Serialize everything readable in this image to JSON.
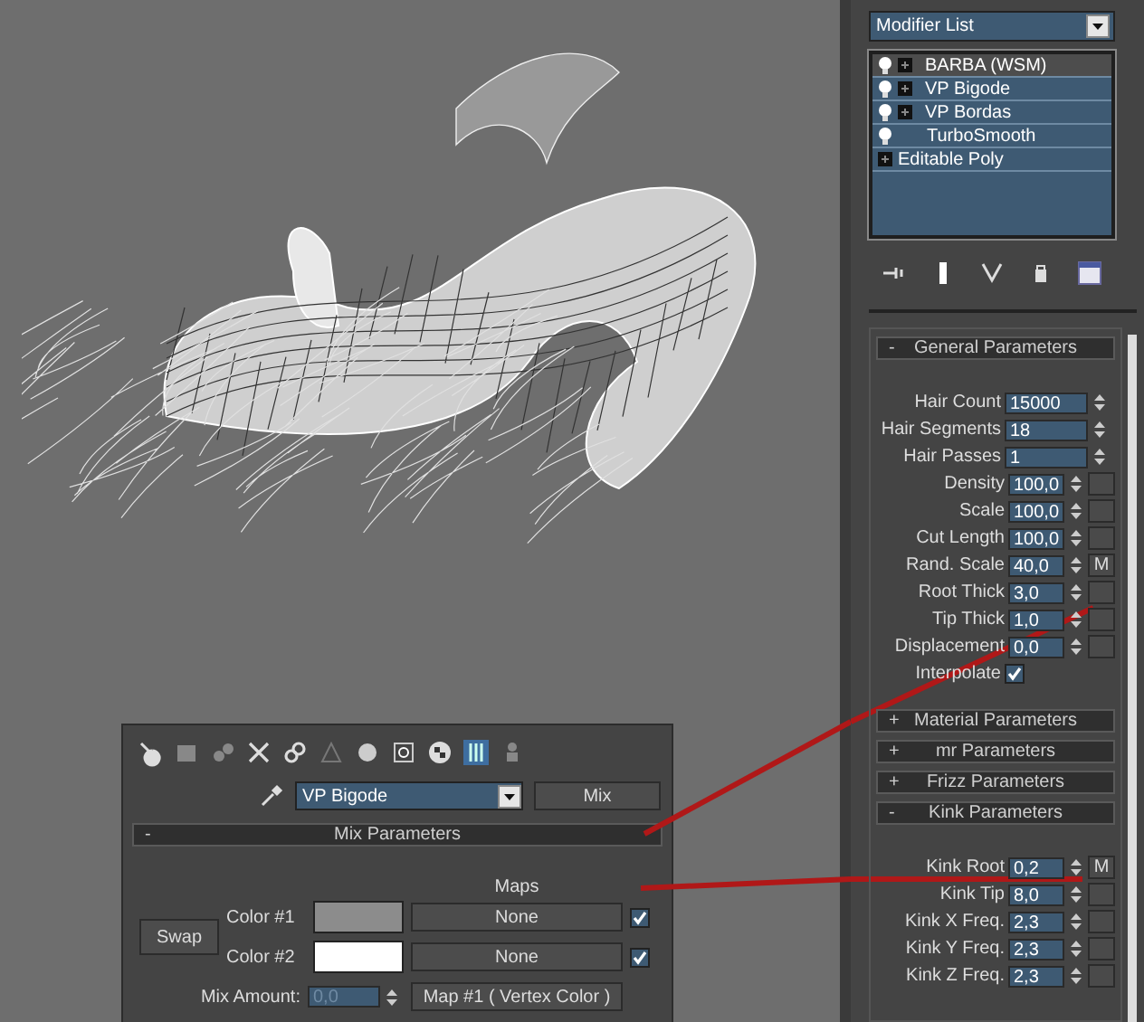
{
  "command_panel": {
    "modifier_list": {
      "label": "Modifier List"
    },
    "modifier_stack": [
      {
        "name": "BARBA (WSM)",
        "kind": "wsm",
        "selected": true
      },
      {
        "name": "VP Bigode",
        "kind": "group",
        "selected": false
      },
      {
        "name": "VP Bordas",
        "kind": "group",
        "selected": false
      },
      {
        "name": "TurboSmooth",
        "kind": "modifier",
        "selected": false
      },
      {
        "name": "Editable Poly",
        "kind": "base",
        "selected": false
      }
    ],
    "rollouts": [
      {
        "sign": "-",
        "title": "General Parameters",
        "params": [
          {
            "label": "Hair Count",
            "value": "15000",
            "kind": "wide"
          },
          {
            "label": "Hair Segments",
            "value": "18",
            "kind": "wide"
          },
          {
            "label": "Hair Passes",
            "value": "1",
            "kind": "wide"
          },
          {
            "label": "Density",
            "value": "100,0",
            "kind": "mapped"
          },
          {
            "label": "Scale",
            "value": "100,0",
            "kind": "mapped"
          },
          {
            "label": "Cut Length",
            "value": "100,0",
            "kind": "mapped"
          },
          {
            "label": "Rand. Scale",
            "value": "40,0",
            "kind": "mapped",
            "map": "M"
          },
          {
            "label": "Root Thick",
            "value": "3,0",
            "kind": "mapped"
          },
          {
            "label": "Tip Thick",
            "value": "1,0",
            "kind": "mapped"
          },
          {
            "label": "Displacement",
            "value": "0,0",
            "kind": "mapped"
          },
          {
            "label": "Interpolate",
            "kind": "checkbox",
            "checked": true
          }
        ]
      },
      {
        "sign": "+",
        "title": "Material Parameters"
      },
      {
        "sign": "+",
        "title": "mr Parameters"
      },
      {
        "sign": "+",
        "title": "Frizz Parameters"
      },
      {
        "sign": "-",
        "title": "Kink Parameters",
        "params": [
          {
            "label": "Kink Root",
            "value": "0,2",
            "kind": "mapped",
            "map": "M"
          },
          {
            "label": "Kink Tip",
            "value": "8,0",
            "kind": "mapped"
          },
          {
            "label": "Kink X Freq.",
            "value": "2,3",
            "kind": "mapped"
          },
          {
            "label": "Kink Y Freq.",
            "value": "2,3",
            "kind": "mapped"
          },
          {
            "label": "Kink Z Freq.",
            "value": "2,3",
            "kind": "mapped"
          }
        ]
      }
    ]
  },
  "material_editor": {
    "material_name": "VP Bigode",
    "material_type": "Mix",
    "rollout": {
      "sign": "-",
      "title": "Mix Parameters"
    },
    "maps_header": "Maps",
    "swap": "Swap",
    "colors": [
      {
        "label": "Color #1",
        "color": "#8c8c8c",
        "map": "None",
        "checked": true
      },
      {
        "label": "Color #2",
        "color": "#ffffff",
        "map": "None",
        "checked": true
      }
    ],
    "mix_amount": {
      "label": "Mix Amount:",
      "value": "0,0",
      "disabled": true,
      "map": "Map #1  ( Vertex Color )"
    }
  }
}
